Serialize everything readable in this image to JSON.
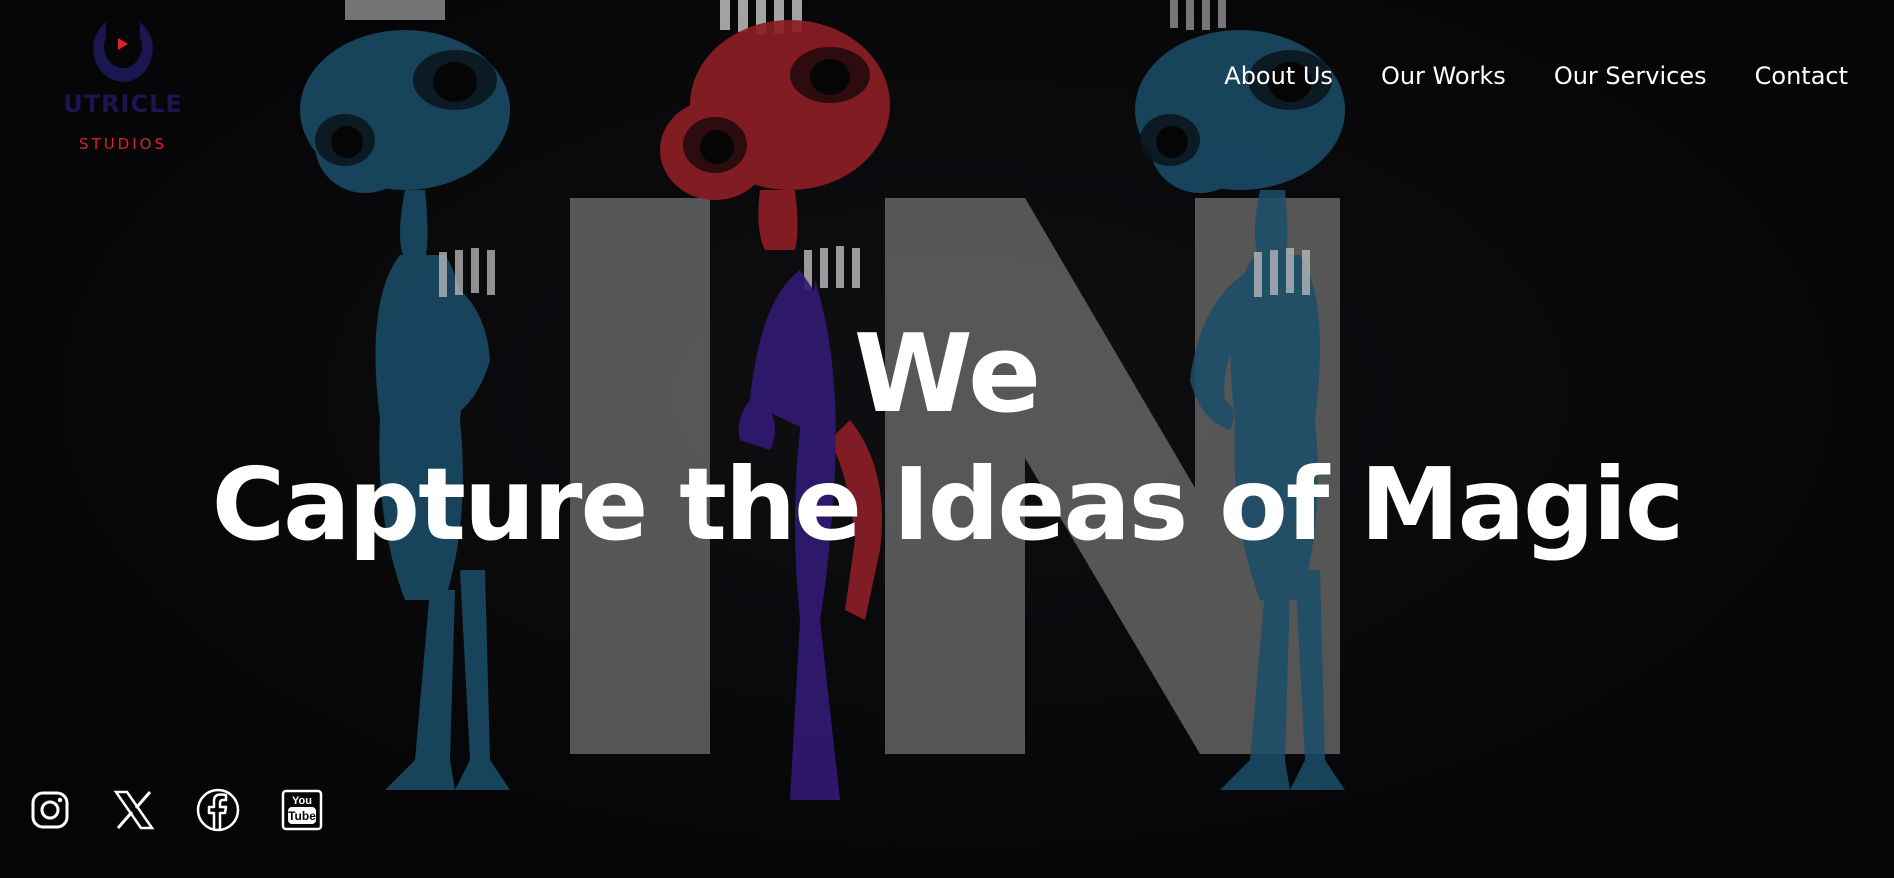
{
  "brand": {
    "name": "UTRICLE",
    "tagline": "STUDIOS",
    "colors": {
      "primary": "#1c1650",
      "accent": "#d8232b"
    }
  },
  "nav": {
    "items": [
      {
        "label": "About Us"
      },
      {
        "label": "Our Works"
      },
      {
        "label": "Our Services"
      },
      {
        "label": "Contact"
      }
    ]
  },
  "hero": {
    "line1": "We",
    "line2": "Capture the Ideas of Magic",
    "background_letters": "IN"
  },
  "socials": [
    {
      "icon": "instagram-icon"
    },
    {
      "icon": "x-icon"
    },
    {
      "icon": "facebook-icon"
    },
    {
      "icon": "youtube-icon"
    }
  ],
  "colors": {
    "background": "#070709",
    "figure_blue": "#1f5f80",
    "figure_red": "#a8232c",
    "figure_purple": "#3b1f8c",
    "letters": "#8c8c8c"
  }
}
